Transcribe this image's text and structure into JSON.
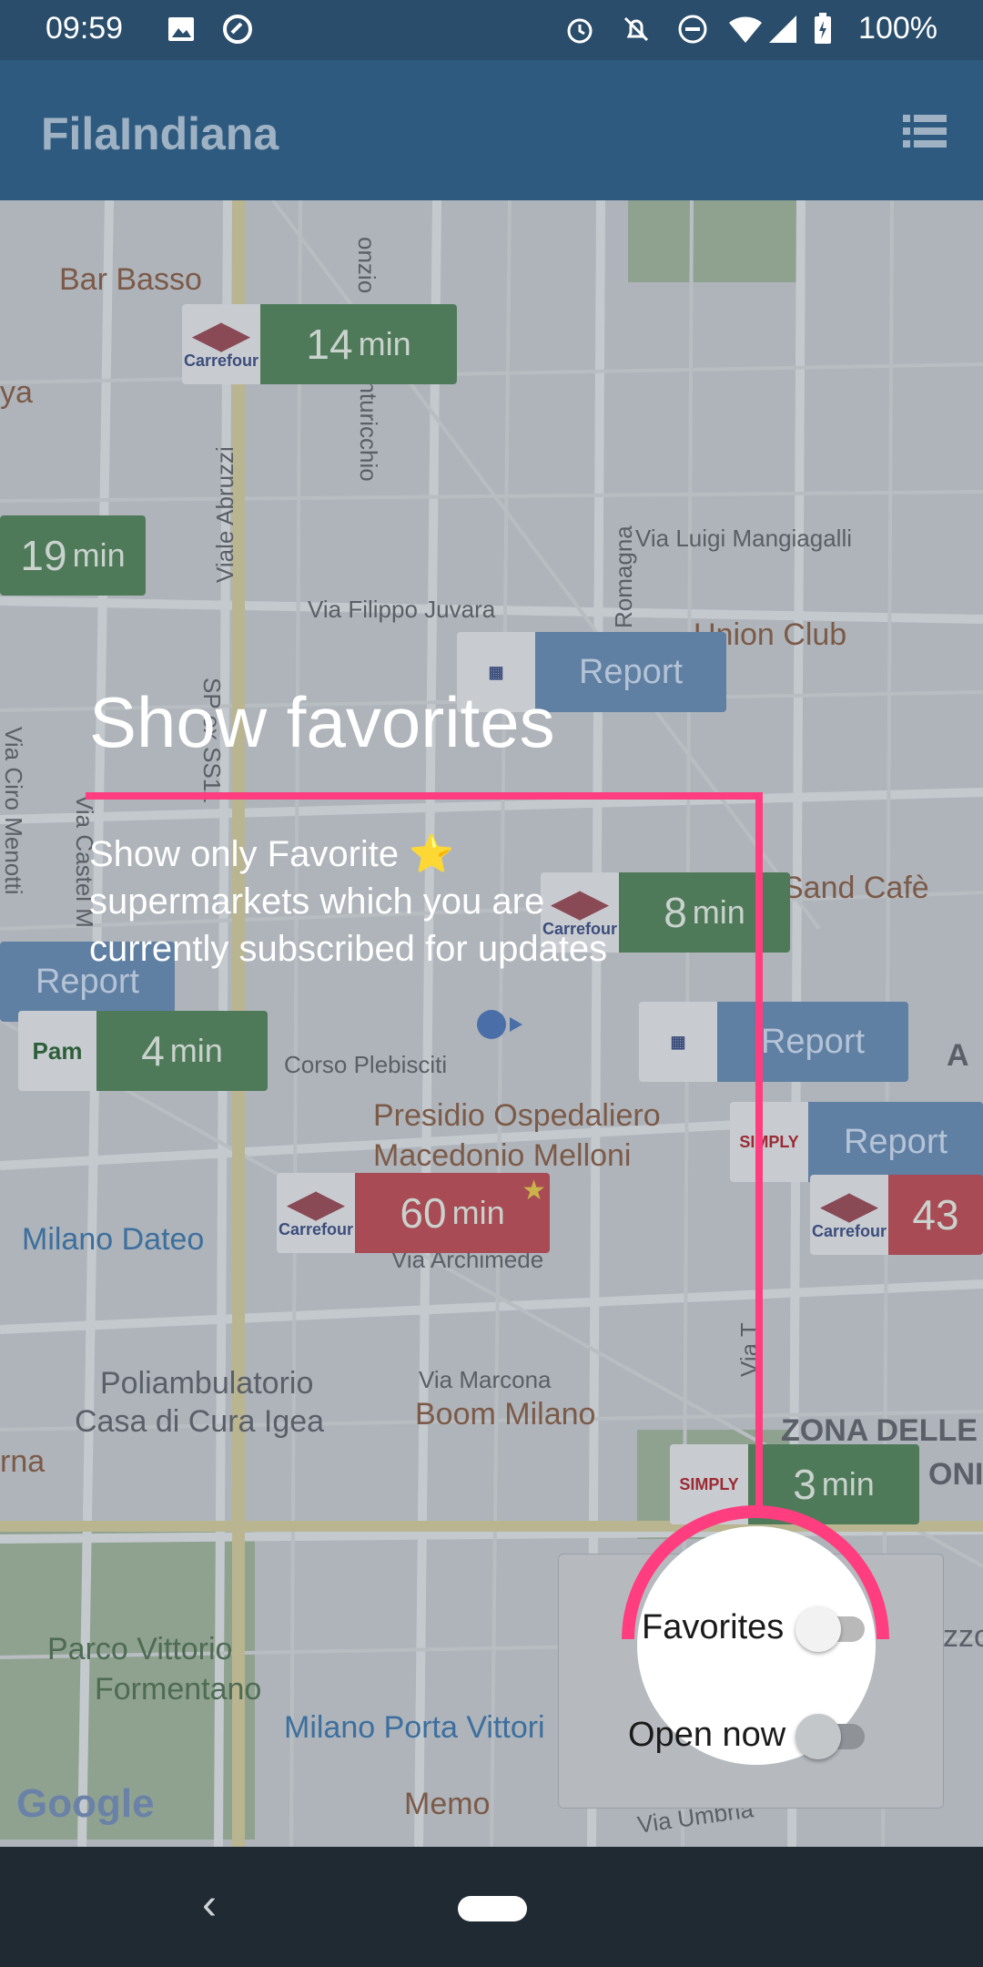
{
  "status": {
    "time": "09:59",
    "battery": "100%",
    "icons": [
      "image-icon",
      "sync-icon",
      "alarm-icon",
      "notifications-off-icon",
      "do-not-disturb-icon",
      "wifi-icon",
      "signal-icon",
      "battery-charging-icon"
    ]
  },
  "app_bar": {
    "title": "FilaIndiana",
    "menu_icon": "list-icon"
  },
  "map": {
    "places": {
      "bar_basso": "Bar Basso",
      "union_club": "Union Club",
      "sand_cafe": "Sand Cafè",
      "presidio_1": "Presidio Ospedaliero",
      "presidio_2": "Macedonio Melloni",
      "milano_dateo": "Milano Dateo",
      "poliambulatorio_1": "Poliambulatorio",
      "poliambulatorio_2": "Casa di Cura Igea",
      "boom_milano": "Boom Milano",
      "zona_delle": "ZONA DELLE",
      "parco_1": "Parco Vittorio",
      "parco_2": "Formentano",
      "porta_vittoria": "Milano Porta Vittori",
      "memo": "Memo",
      "rna": "rna",
      "ya": "ya",
      "zzo": "zzo",
      "oni": "ONI",
      "a": "A"
    },
    "streets": {
      "pinturicchio": "Via Pinturicchio",
      "abruzzi": "Viale Abruzzi",
      "mangiagalli": "Via Luigi Mangiagalli",
      "juvara": "Via Filippo Juvara",
      "romagna": "Romagna",
      "plebisciti": "Corso Plebisciti",
      "archimede": "Via Archimede",
      "marcona": "Via Marcona",
      "castel_morrone": "Via Castel M",
      "ciro_menotti": "Via Ciro Menotti",
      "sp": "SP ex SS11",
      "umbria": "Via Umbria",
      "via_t": "Via T",
      "onzio": "onzio"
    },
    "pins": [
      {
        "brand": "Carrefour",
        "minutes": "14",
        "unit": "min",
        "status": "green"
      },
      {
        "minutes": "19",
        "unit": "min",
        "status": "green"
      },
      {
        "brand": "Carrefour",
        "minutes": "8",
        "unit": "min",
        "status": "green"
      },
      {
        "brand": "Pam",
        "minutes": "4",
        "unit": "min",
        "status": "green"
      },
      {
        "brand": "Carrefour",
        "minutes": "60",
        "unit": "min",
        "status": "red",
        "favorite": true
      },
      {
        "brand": "Carrefour",
        "minutes": "43",
        "status": "red"
      },
      {
        "brand": "SIMPLY",
        "minutes": "3",
        "unit": "min",
        "status": "green"
      }
    ],
    "report_label": "Report",
    "google": "Google"
  },
  "tutorial": {
    "title": "Show favorites",
    "text_line1": "Show only Favorite ⭐",
    "text_line2": "supermarkets which you are",
    "text_line3": "currently subscribed for updates",
    "accent_color": "#ff3d7f"
  },
  "filters": {
    "favorites_label": "Favorites",
    "favorites_on": false,
    "open_now_label": "Open now",
    "open_now_on": false
  },
  "nav": {
    "back_icon": "back-icon",
    "home_icon": "home-pill-icon"
  }
}
